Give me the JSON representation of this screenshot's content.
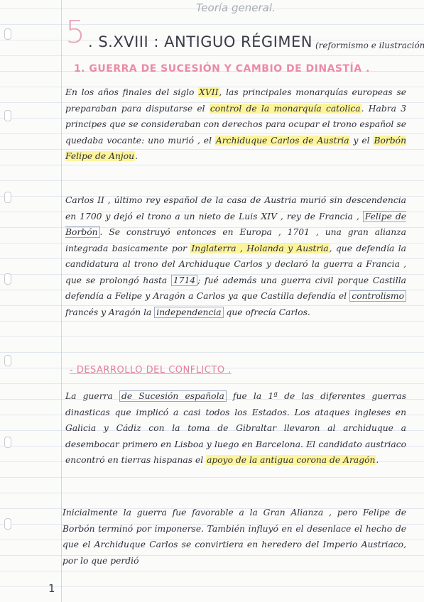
{
  "header": {
    "teoria": "Teoría general.",
    "number": "5",
    "title": ". S.XVIII : ANTIGUO RÉGIMEN",
    "subtitle": "(reformismo e ilustración)"
  },
  "sections": {
    "h1": "1. GUERRA DE SUCESIÓN Y CAMBIO DE DINASTÍA .",
    "h2": "- DESARROLLO DEL CONFLICTO ."
  },
  "p1": {
    "a": "En los años finales del siglo ",
    "b": "XVII",
    "c": ", las principales monarquías europeas se preparaban para disputarse el ",
    "d": "control de la monarquía catolica",
    "e": ". Habra 3 principes que se consideraban con derechos para ocupar el trono español se quedaba vocante: uno murió , el ",
    "f": "Archiduque Carlos de Austria",
    "g": " y el ",
    "h": "Borbón Felipe de Anjou",
    "i": "."
  },
  "p2": {
    "a": "Carlos II , último rey español de la casa de Austria murió sin descendencia en 1700 y dejó el trono a un nieto de Luis XIV , rey de Francia , ",
    "b": "Felipe de Borbón",
    "c": ". Se construyó entonces en Europa , 1701 , una gran alianza integrada basicamente por ",
    "d": "Inglaterra , Holanda y Austria",
    "e": ", que defendía la candidatura al trono del Archiduque Carlos y declaró la guerra a Francia , que se prolongó hasta ",
    "f": "1714",
    "g": "; fué además una guerra civil porque Castilla defendía a Felipe y Aragón a Carlos ya que Castilla defendía el ",
    "h": "controlismo",
    "i": " francés y Aragón la ",
    "j": "independencia",
    "k": " que ofrecía Carlos."
  },
  "p3": {
    "a": "La guerra ",
    "b": "de Sucesión española",
    "c": " fue la 1ª de las diferentes guerras dinasticas que implicó a casi todos los Estados. Los ataques ingleses en Galicia y Cádiz con la toma de Gibraltar llevaron al archiduque a desembocar primero en Lisboa y luego en Barcelona. El candidato austriaco encontró en tierras hispanas el ",
    "d": "apoyo de la antigua corona de Aragón",
    "e": "."
  },
  "p4": {
    "a": "Inicialmente la guerra fue favorable a la Gran Alianza , pero Felipe de Borbón terminó por imponerse. También influyó en el desenlace el hecho de que el Archiduque Carlos se convirtiera en heredero del Imperio Austriaco, por lo que perdió"
  },
  "page_number": "1"
}
